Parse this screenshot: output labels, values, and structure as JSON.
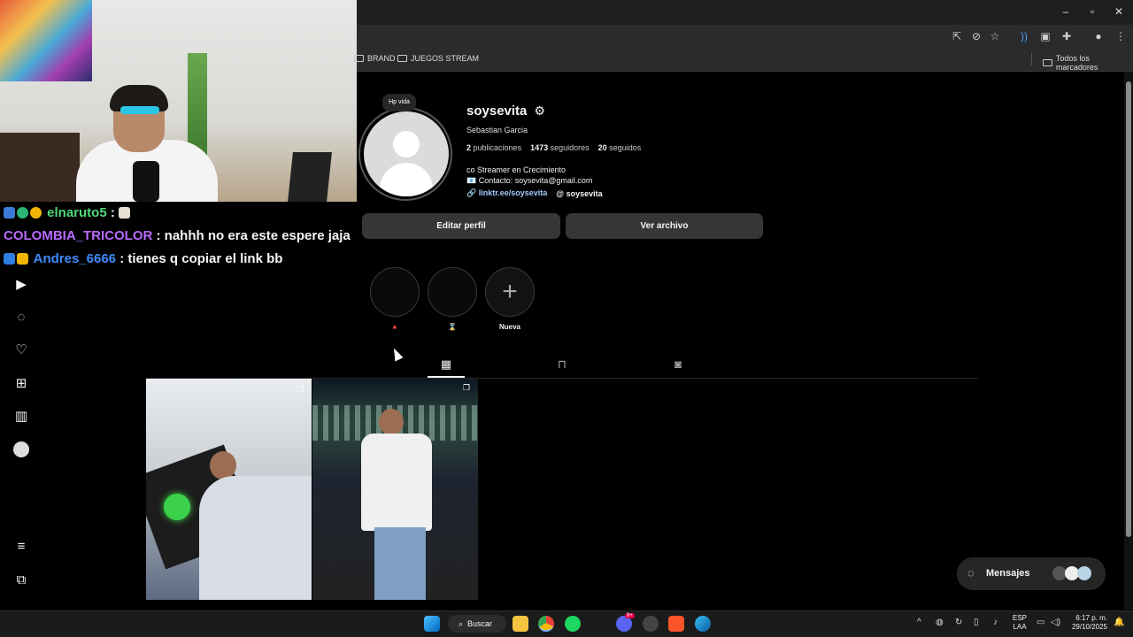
{
  "browser": {
    "bookmarks": [
      "BRAND",
      "JUEGOS STREAM"
    ],
    "all_bookmarks_label": "Todos los marcadores"
  },
  "chat": [
    {
      "user": "elnaruto5",
      "sep": " : ",
      "text": "",
      "color": "#4fd97a"
    },
    {
      "user": "COLOMBIA_TRICOLOR",
      "sep": " : ",
      "text": "nahhh no era este espere jaja",
      "color": "#b86bff"
    },
    {
      "user": "Andres_6666",
      "sep": " : ",
      "text": "tienes q copiar el link bb",
      "color": "#3f8cff"
    }
  ],
  "profile": {
    "username": "soysevita",
    "full_name": "Sebastian Garcia",
    "stats": {
      "posts_count": "2",
      "posts_label": "publicaciones",
      "followers_count": "1473",
      "followers_label": "seguidores",
      "following_count": "20",
      "following_label": "seguidos"
    },
    "bio_line1": "co Streamer en Crecimiento",
    "bio_line2": "📧 Contacto: soysevita@gmail.com",
    "link": "linktr.ee/soysevita",
    "threads": "soysevita",
    "note": "Hp vida",
    "edit_button": "Editar perfil",
    "archive_button": "Ver archivo"
  },
  "highlights": [
    {
      "label": "🔺"
    },
    {
      "label": "⌛"
    },
    {
      "label": "Nueva"
    }
  ],
  "messages_label": "Mensajes",
  "taskbar": {
    "search_label": "Buscar",
    "notif_badge": "9+",
    "lang_line1": "ESP",
    "lang_line2": "LAA",
    "time": "6:17 p. m.",
    "date": "29/10/2025"
  },
  "colors": {
    "link": "#e0f1ff",
    "button_bg": "#363636",
    "ig_bg": "#000000"
  }
}
